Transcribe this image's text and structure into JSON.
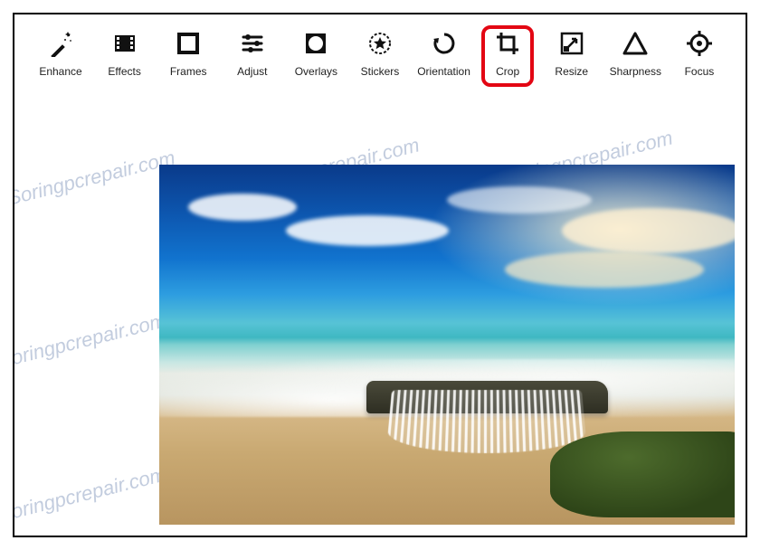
{
  "toolbar": {
    "items": [
      {
        "id": "enhance",
        "label": "Enhance"
      },
      {
        "id": "effects",
        "label": "Effects"
      },
      {
        "id": "frames",
        "label": "Frames"
      },
      {
        "id": "adjust",
        "label": "Adjust"
      },
      {
        "id": "overlays",
        "label": "Overlays"
      },
      {
        "id": "stickers",
        "label": "Stickers"
      },
      {
        "id": "orientation",
        "label": "Orientation"
      },
      {
        "id": "crop",
        "label": "Crop"
      },
      {
        "id": "resize",
        "label": "Resize"
      },
      {
        "id": "sharpness",
        "label": "Sharpness"
      },
      {
        "id": "focus",
        "label": "Focus"
      }
    ],
    "highlighted": "crop"
  },
  "watermark": {
    "text": "Soringpcrepair.com"
  },
  "image": {
    "description": "Beach seascape with deep blue sky, clouds, turquoise ocean, white surf cascading over mossy rock onto sandy shore."
  },
  "colors": {
    "highlight": "#e30613",
    "icon": "#111111"
  }
}
